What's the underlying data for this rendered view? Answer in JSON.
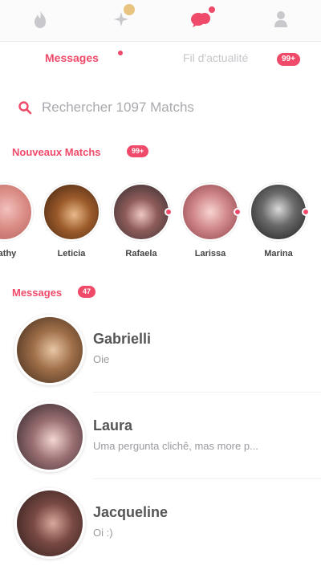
{
  "colors": {
    "accent": "#ef4a6a",
    "muted": "#c7c7cc",
    "gold": "#e5b96a"
  },
  "nav": [
    {
      "icon": "flame-icon"
    },
    {
      "icon": "sparkle-icon"
    },
    {
      "icon": "chat-bubbles-icon"
    },
    {
      "icon": "profile-icon"
    }
  ],
  "tabs": {
    "messages_label": "Messages",
    "feed_label": "Fil d'actualité",
    "feed_badge": "99+"
  },
  "search": {
    "placeholder": "Rechercher 1097 Matchs"
  },
  "new_matches": {
    "title": "Nouveaux Matchs",
    "badge": "99+",
    "items": [
      {
        "name": "Kathy"
      },
      {
        "name": "Leticia"
      },
      {
        "name": "Rafaela"
      },
      {
        "name": "Larissa"
      },
      {
        "name": "Marina"
      }
    ]
  },
  "messages": {
    "title": "Messages",
    "badge": "47",
    "items": [
      {
        "name": "Gabrielli",
        "preview": "Oie"
      },
      {
        "name": "Laura",
        "preview": "Uma pergunta clichê, mas more p..."
      },
      {
        "name": "Jacqueline",
        "preview": "Oi :)"
      }
    ]
  }
}
